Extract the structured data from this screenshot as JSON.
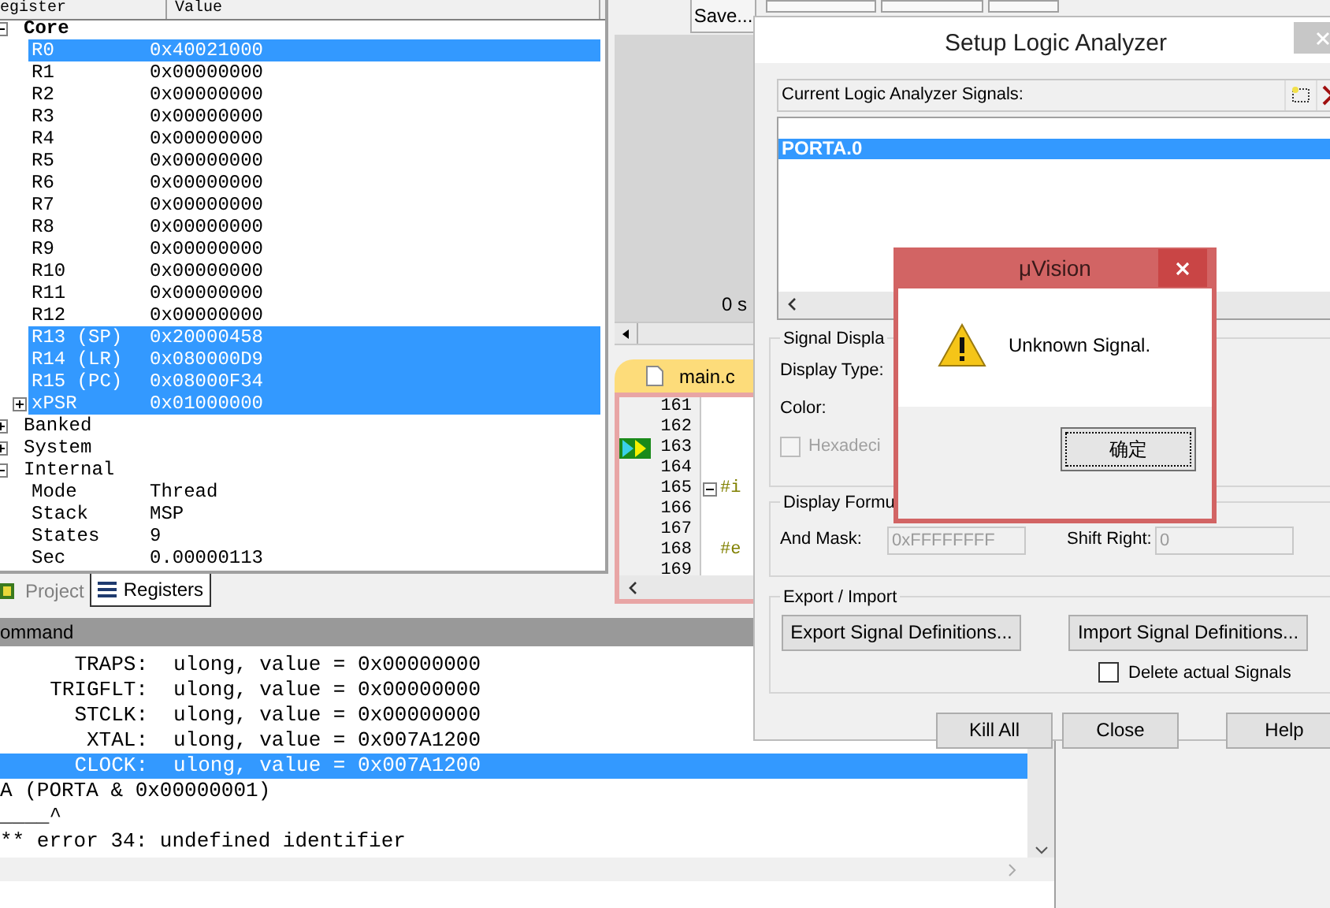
{
  "registers": {
    "columns": [
      "egister",
      "Value"
    ],
    "groups": [
      {
        "name": "Core",
        "expanded": true,
        "children": [
          {
            "name": "R0",
            "value": "0x40021000",
            "selected": true
          },
          {
            "name": "R1",
            "value": "0x00000000",
            "selected": false
          },
          {
            "name": "R2",
            "value": "0x00000000",
            "selected": false
          },
          {
            "name": "R3",
            "value": "0x00000000",
            "selected": false
          },
          {
            "name": "R4",
            "value": "0x00000000",
            "selected": false
          },
          {
            "name": "R5",
            "value": "0x00000000",
            "selected": false
          },
          {
            "name": "R6",
            "value": "0x00000000",
            "selected": false
          },
          {
            "name": "R7",
            "value": "0x00000000",
            "selected": false
          },
          {
            "name": "R8",
            "value": "0x00000000",
            "selected": false
          },
          {
            "name": "R9",
            "value": "0x00000000",
            "selected": false
          },
          {
            "name": "R10",
            "value": "0x00000000",
            "selected": false
          },
          {
            "name": "R11",
            "value": "0x00000000",
            "selected": false
          },
          {
            "name": "R12",
            "value": "0x00000000",
            "selected": false
          },
          {
            "name": "R13 (SP)",
            "value": "0x20000458",
            "selected": true
          },
          {
            "name": "R14 (LR)",
            "value": "0x080000D9",
            "selected": true
          },
          {
            "name": "R15 (PC)",
            "value": "0x08000F34",
            "selected": true
          },
          {
            "name": "xPSR",
            "value": "0x01000000",
            "selected": true,
            "expanded": false
          }
        ]
      },
      {
        "name": "Banked",
        "expanded": false
      },
      {
        "name": "System",
        "expanded": false
      },
      {
        "name": "Internal",
        "expanded": true,
        "children": [
          {
            "name": "Mode",
            "value": "Thread",
            "selected": false
          },
          {
            "name": "Stack",
            "value": "MSP",
            "selected": false
          },
          {
            "name": "States",
            "value": "9",
            "selected": false
          },
          {
            "name": "Sec",
            "value": "0.00000113",
            "selected": false
          }
        ]
      }
    ]
  },
  "panel_tabs": [
    {
      "label": "Project",
      "selected": false
    },
    {
      "label": "Registers",
      "selected": true
    }
  ],
  "toolbar": {
    "save_button": "Save..."
  },
  "waveform": {
    "time_label": "0 s"
  },
  "editor": {
    "tab": "main.c",
    "lines": [
      {
        "number": "161",
        "current": false,
        "fold": false
      },
      {
        "number": "162",
        "current": false,
        "fold": false
      },
      {
        "number": "163",
        "current": true,
        "fold": false
      },
      {
        "number": "164",
        "current": false,
        "fold": false
      },
      {
        "number": "165",
        "current": false,
        "fold": true,
        "code": "#i"
      },
      {
        "number": "166",
        "current": false,
        "fold": false
      },
      {
        "number": "167",
        "current": false,
        "fold": false
      },
      {
        "number": "168",
        "current": false,
        "fold": false,
        "code": "#e"
      },
      {
        "number": "169",
        "current": false,
        "fold": false
      }
    ]
  },
  "command": {
    "title": "ommand",
    "lines": [
      {
        "kind": "field",
        "label": "TRAPS:",
        "text": "ulong, value = 0x00000000",
        "selected": false
      },
      {
        "kind": "field",
        "label": "TRIGFLT:",
        "text": "ulong, value = 0x00000000",
        "selected": false
      },
      {
        "kind": "field",
        "label": "STCLK:",
        "text": "ulong, value = 0x00000000",
        "selected": false
      },
      {
        "kind": "field",
        "label": "XTAL:",
        "text": "ulong, value = 0x007A1200",
        "selected": false
      },
      {
        "kind": "field",
        "label": "CLOCK:",
        "text": "ulong, value = 0x007A1200",
        "selected": true
      },
      {
        "kind": "plain",
        "text": "A (PORTA & 0x00000001)",
        "selected": false
      },
      {
        "kind": "plain",
        "text": "____^",
        "selected": false
      },
      {
        "kind": "plain",
        "text": "** error 34: undefined identifier",
        "selected": false
      }
    ]
  },
  "logic_analyzer": {
    "title": "Setup Logic Analyzer",
    "signals_label": "Current Logic Analyzer Signals:",
    "signals": [
      {
        "name": "PORTA.0",
        "selected": true
      }
    ],
    "display_group": "Signal Displa",
    "display_type_label": "Display Type:",
    "color_label": "Color:",
    "hex_checkbox": {
      "label": "Hexadeci",
      "checked": false,
      "disabled": true
    },
    "formula_group": "Display Formu",
    "and_mask": {
      "label": "And Mask:",
      "value": "0xFFFFFFFF",
      "disabled": true
    },
    "shift_right": {
      "label": "Shift Right:",
      "value": "0",
      "disabled": true
    },
    "export_group": "Export / Import",
    "export_button": "Export Signal Definitions...",
    "import_button": "Import Signal Definitions...",
    "delete_checkbox": {
      "label": "Delete actual Signals",
      "checked": false
    },
    "buttons": [
      "Kill All",
      "Close",
      "Help"
    ]
  },
  "message_box": {
    "title": "μVision",
    "message": "Unknown Signal.",
    "ok_button": "确定"
  }
}
